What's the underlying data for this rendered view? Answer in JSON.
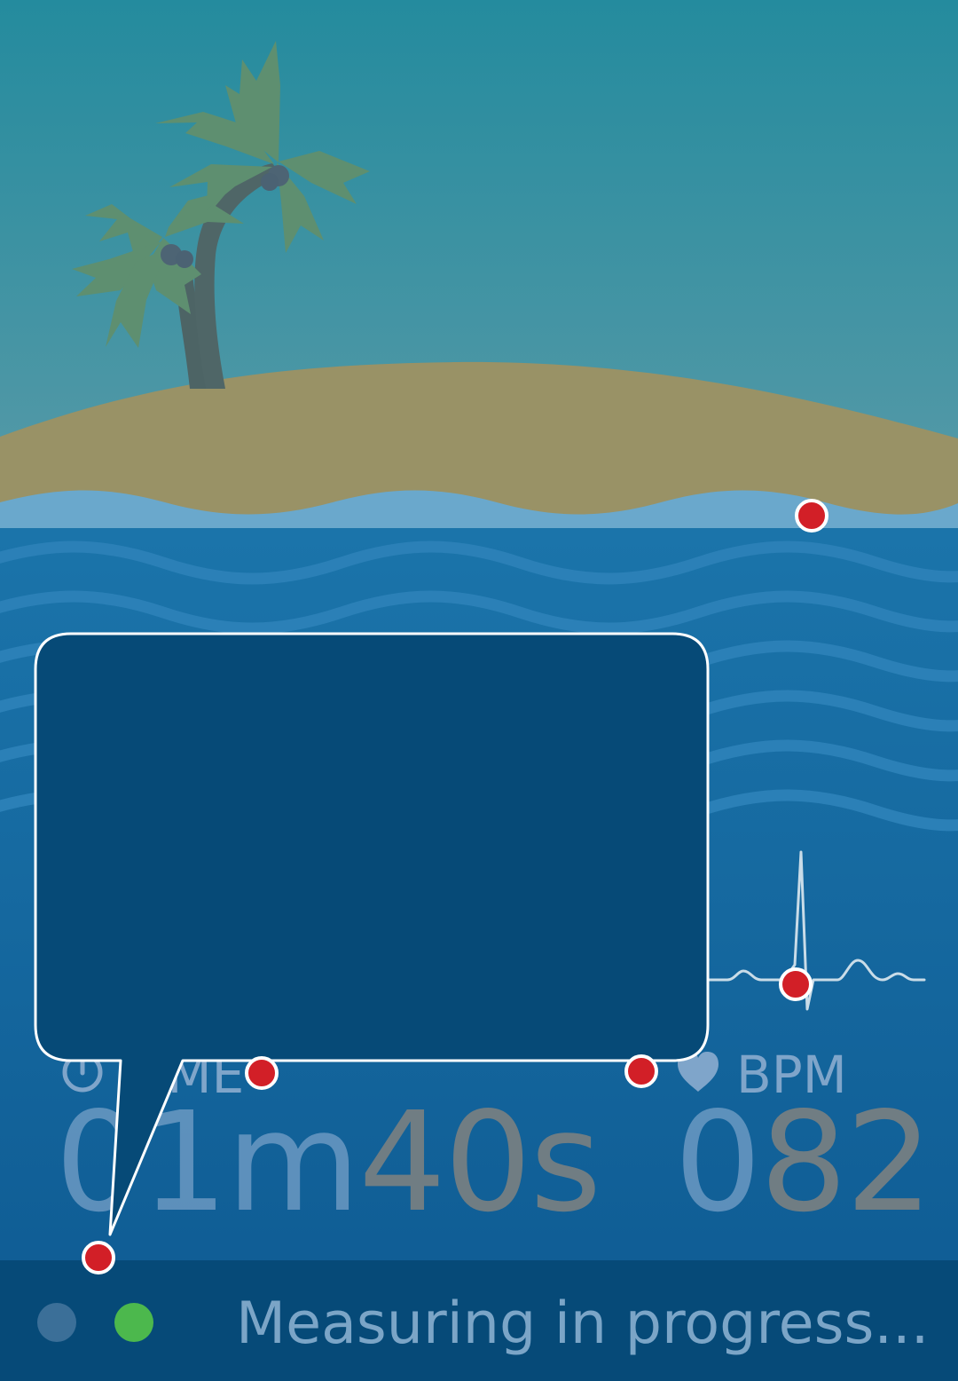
{
  "metrics": {
    "time": {
      "label": "TIME",
      "value_prefix": "01m",
      "value_suffix": "40s",
      "icon": "timer-icon"
    },
    "bpm": {
      "label": "BPM",
      "value_prefix": "0",
      "value_suffix": "82",
      "icon": "heart-icon"
    }
  },
  "status": {
    "text": "Measuring in progress..."
  },
  "colors": {
    "sky_top": "#248b9e",
    "sky_bottom": "#5b9ba8",
    "sand": "#999266",
    "water": "#0f5a92",
    "marker": "#d21f27",
    "status_active": "#4cb84d"
  },
  "icons": {
    "tree": "palm-tree-icon",
    "pulse": "heartbeat-line-icon",
    "callout": "speech-bubble-icon"
  }
}
